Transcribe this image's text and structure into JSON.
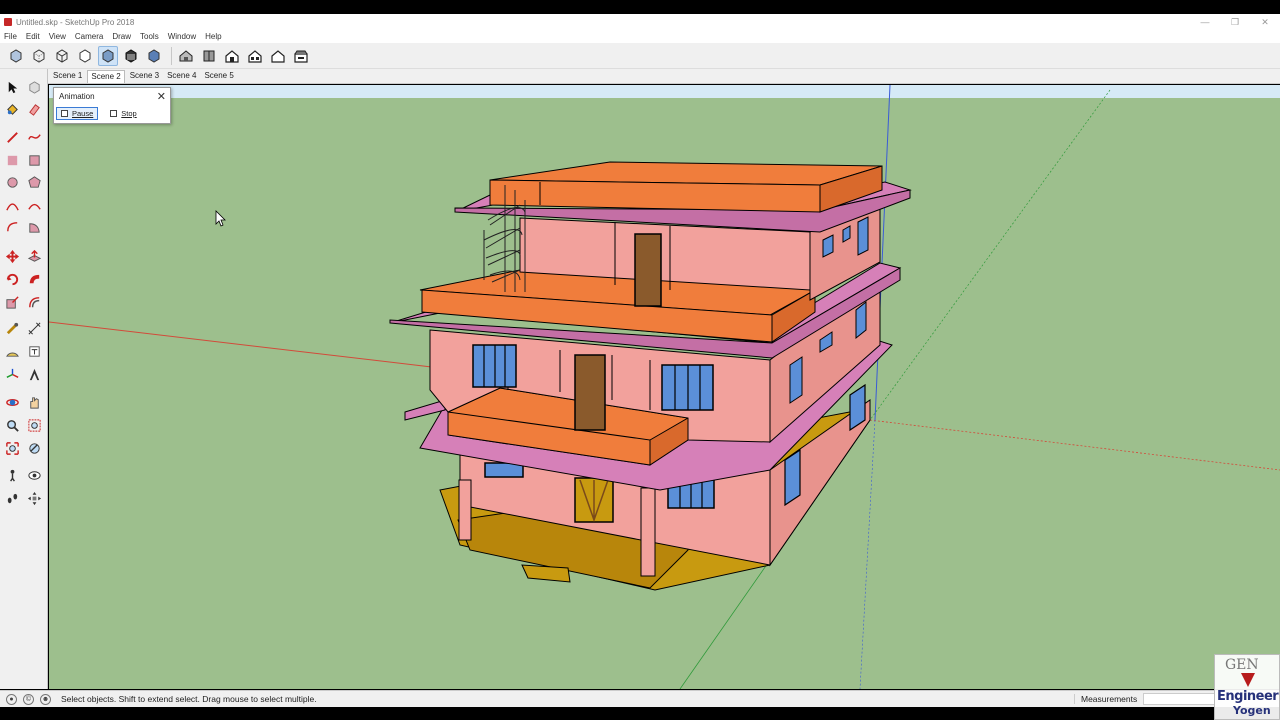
{
  "window": {
    "title": "Untitled.skp - SketchUp Pro 2018",
    "controls": [
      "minimize-icon",
      "maximize-icon",
      "close-icon"
    ]
  },
  "menu": {
    "items": [
      "File",
      "Edit",
      "View",
      "Camera",
      "Draw",
      "Tools",
      "Window",
      "Help"
    ]
  },
  "toolbar": {
    "views_icons": [
      "xray-icon",
      "back-edges-icon",
      "wireframe-icon",
      "hidden-line-icon",
      "shaded-icon",
      "shaded-textures-icon",
      "monochrome-icon"
    ],
    "camera_icons": [
      "iso-icon",
      "top-icon",
      "front-icon",
      "right-icon",
      "back-icon",
      "left-icon"
    ],
    "active_icon": "shaded-icon"
  },
  "scenes": {
    "tabs": [
      "Scene 1",
      "Scene 2",
      "Scene 3",
      "Scene 4",
      "Scene 5"
    ],
    "active": "Scene 2"
  },
  "animation_dialog": {
    "title": "Animation",
    "pause_label": "Pause",
    "stop_label": "Stop"
  },
  "left_tools": [
    "select",
    "component",
    "paint",
    "eraser",
    "line",
    "freehand",
    "rectangle",
    "rotated-rectangle",
    "circle",
    "polygon",
    "arc",
    "two-point-arc",
    "three-point-arc",
    "pie",
    "move",
    "push-pull",
    "rotate",
    "follow-me",
    "scale",
    "offset",
    "tape-measure",
    "dimension",
    "protractor",
    "text",
    "axes",
    "3d-text",
    "orbit",
    "pan",
    "zoom",
    "zoom-window",
    "zoom-extents",
    "previous",
    "position-camera",
    "look-around",
    "walk",
    "section-plane"
  ],
  "status": {
    "message": "Select objects. Shift to extend select. Drag mouse to select multiple.",
    "measurements_label": "Measurements",
    "measurements_value": ""
  },
  "watermark": {
    "line1": "GEN",
    "line2": "Engineer",
    "line3": "Yogen"
  },
  "colors": {
    "ground": "#9dbf8d",
    "sky": "#d6eaf6",
    "wall": "#f2a19c",
    "parapet": "#f07d3c",
    "slab": "#d680b8",
    "plinth": "#c89a10",
    "window": "#5b8fd8",
    "door": "#8a5a2c"
  }
}
